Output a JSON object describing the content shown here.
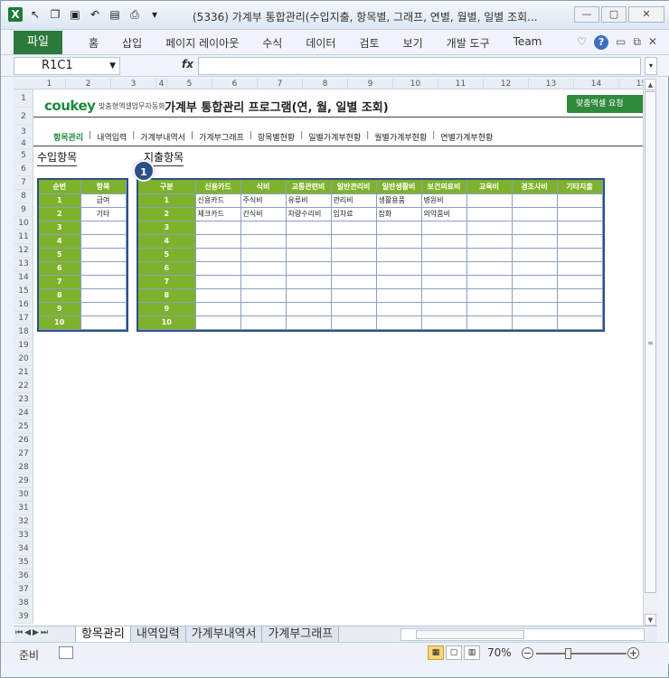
{
  "window": {
    "title": "(5336) 가계부 통합관리(수입지출, 항목별, 그래프, 연별, 월별, 일별 조회...",
    "buttons": {
      "minimize": "—",
      "restore": "▢",
      "close": "✕"
    }
  },
  "ribbon": {
    "file_tab": "파일",
    "tabs": [
      "홈",
      "삽입",
      "페이지 레이아웃",
      "수식",
      "데이터",
      "검토",
      "보기",
      "개발 도구",
      "Team"
    ],
    "help_icon": "?"
  },
  "formula_bar": {
    "name_box": "R1C1",
    "fx_label": "fx",
    "formula": ""
  },
  "columns": [
    "1",
    "2",
    "3",
    "4",
    "5",
    "6",
    "7",
    "8",
    "9",
    "10",
    "11",
    "12",
    "13",
    "14",
    "15"
  ],
  "rows": [
    "1",
    "2",
    "3",
    "4",
    "5",
    "6",
    "7",
    "8",
    "9",
    "10",
    "11",
    "12",
    "13",
    "14",
    "15",
    "16",
    "17",
    "18",
    "19",
    "20",
    "21",
    "22",
    "23",
    "24",
    "25",
    "26",
    "27",
    "28",
    "29",
    "30",
    "31",
    "32",
    "33",
    "34",
    "35",
    "36",
    "37",
    "38",
    "39"
  ],
  "sheet": {
    "brand": "coukey",
    "brand_sub": "맞춤형엑셀업무자동화",
    "program_title": "가계부 통합관리 프로그램(연, 월, 일별 조회)",
    "request_button": "맞춤엑셀 요청",
    "menu": [
      "항목관리",
      "내역입력",
      "가계부내역서",
      "가계부그래프",
      "항목별현황",
      "일별가계부현황",
      "월별가계부현황",
      "연별가계부현황"
    ],
    "income_section": "수입항목",
    "expense_section": "지출항목",
    "badge": "1",
    "income_table": {
      "headers": [
        "순번",
        "항목"
      ],
      "rows": [
        [
          "1",
          "급여"
        ],
        [
          "2",
          "기타"
        ],
        [
          "3",
          ""
        ],
        [
          "4",
          ""
        ],
        [
          "5",
          ""
        ],
        [
          "6",
          ""
        ],
        [
          "7",
          ""
        ],
        [
          "8",
          ""
        ],
        [
          "9",
          ""
        ],
        [
          "10",
          ""
        ]
      ]
    },
    "expense_table": {
      "headers": [
        "구분",
        "신용카드",
        "식비",
        "교통관련비",
        "일반관리비",
        "일반생활비",
        "보건의료비",
        "교육비",
        "경조사비",
        "기타지출"
      ],
      "rows": [
        [
          "1",
          "신용카드",
          "주식비",
          "유류비",
          "관리비",
          "생활용품",
          "병원비",
          "",
          "",
          ""
        ],
        [
          "2",
          "체크카드",
          "간식비",
          "차량수리비",
          "임차료",
          "잡화",
          "의약품비",
          "",
          "",
          ""
        ],
        [
          "3",
          "",
          "",
          "",
          "",
          "",
          "",
          "",
          "",
          ""
        ],
        [
          "4",
          "",
          "",
          "",
          "",
          "",
          "",
          "",
          "",
          ""
        ],
        [
          "5",
          "",
          "",
          "",
          "",
          "",
          "",
          "",
          "",
          ""
        ],
        [
          "6",
          "",
          "",
          "",
          "",
          "",
          "",
          "",
          "",
          ""
        ],
        [
          "7",
          "",
          "",
          "",
          "",
          "",
          "",
          "",
          "",
          ""
        ],
        [
          "8",
          "",
          "",
          "",
          "",
          "",
          "",
          "",
          "",
          ""
        ],
        [
          "9",
          "",
          "",
          "",
          "",
          "",
          "",
          "",
          "",
          ""
        ],
        [
          "10",
          "",
          "",
          "",
          "",
          "",
          "",
          "",
          "",
          ""
        ]
      ]
    }
  },
  "sheet_tabs": [
    "항목관리",
    "내역입력",
    "가계부내역서",
    "가계부그래프"
  ],
  "active_sheet": "항목관리",
  "status": {
    "ready": "준비",
    "zoom": "70%"
  },
  "colors": {
    "accent_green": "#7fb22c",
    "table_border": "#2c4f8a",
    "file_tab": "#2b7a3c"
  }
}
